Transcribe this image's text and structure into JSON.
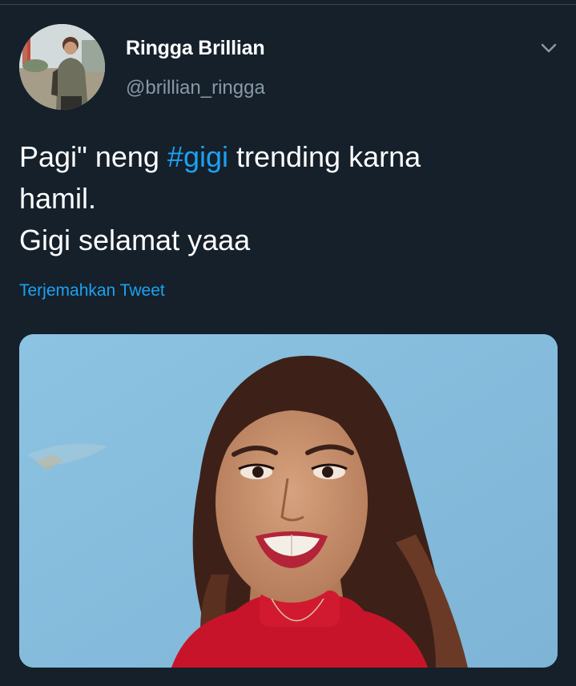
{
  "tweet": {
    "author": {
      "display_name": "Ringga Brillian",
      "handle": "@brillian_ringga"
    },
    "text": {
      "line1_before": "Pagi\" neng ",
      "hashtag": "#gigi",
      "line1_after": " trending karna",
      "line2": "hamil.",
      "line3": "Gigi selamat yaaa"
    },
    "translate_label": "Terjemahkan Tweet",
    "icons": {
      "menu": "chevron-down-icon"
    }
  },
  "colors": {
    "background": "#15202b",
    "link": "#1da1f2",
    "secondary_text": "#8899a6",
    "primary_text": "#ffffff"
  }
}
